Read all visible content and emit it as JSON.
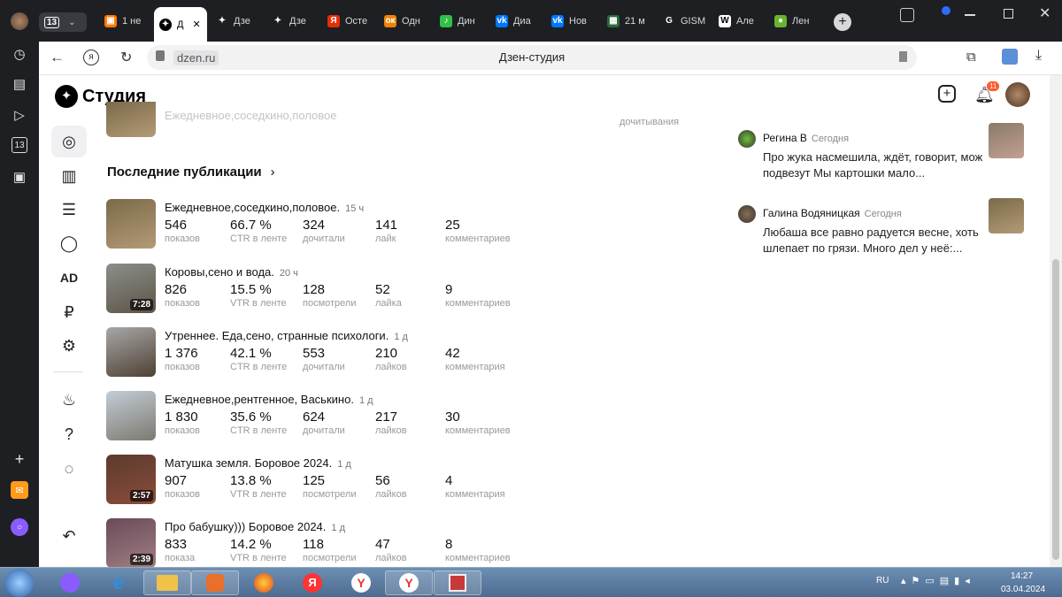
{
  "browser": {
    "tabs": [
      {
        "label": "1 не",
        "color": "#ff7a00",
        "glyph": "▣"
      },
      {
        "label": "Д",
        "color": "#000000",
        "glyph": "✦",
        "active": true
      },
      {
        "label": "Дзе",
        "color": "#1e1f23",
        "glyph": "✦"
      },
      {
        "label": "Дзе",
        "color": "#1e1f23",
        "glyph": "✦"
      },
      {
        "label": "Осте",
        "color": "#e62e04",
        "glyph": "Я"
      },
      {
        "label": "Одн",
        "color": "#ee8208",
        "glyph": "ок"
      },
      {
        "label": "Дин",
        "color": "#31c048",
        "glyph": "♪"
      },
      {
        "label": "Диа",
        "color": "#0077ff",
        "glyph": "vk"
      },
      {
        "label": "Нов",
        "color": "#0077ff",
        "glyph": "vk"
      },
      {
        "label": "21 м",
        "color": "#2a6b3a",
        "glyph": "▦"
      },
      {
        "label": "GISM",
        "color": "#1e1f23",
        "glyph": "G"
      },
      {
        "label": "Але",
        "color": "#ffffff",
        "glyph": "W"
      },
      {
        "label": "Лен",
        "color": "#6ab42d",
        "glyph": "●"
      }
    ],
    "tab_count_badge": "13",
    "url": "dzen.ru",
    "page_title": "Дзен-студия"
  },
  "studio": {
    "logo_text": "Студия",
    "notification_count": "11",
    "partial_row": {
      "title": "Ежедневное,соседкино,половое",
      "stat_label": "дочитывания"
    },
    "section_title": "Последние публикации",
    "nav_ad_label": "AD",
    "publications": [
      {
        "title": "Ежедневное,соседкино,половое.",
        "age": "15 ч",
        "duration": "",
        "colors": [
          "#7a6a4a",
          "#b49a76"
        ],
        "stats": [
          {
            "v": "546",
            "l": "показов"
          },
          {
            "v": "66.7 %",
            "l": "CTR в ленте"
          },
          {
            "v": "324",
            "l": "дочитали"
          },
          {
            "v": "141",
            "l": "лайк"
          },
          {
            "v": "25",
            "l": "комментариев"
          }
        ]
      },
      {
        "title": "Коровы,сено и вода.",
        "age": "20 ч",
        "duration": "7:28",
        "colors": [
          "#8a8f8a",
          "#5d5346"
        ],
        "stats": [
          {
            "v": "826",
            "l": "показов"
          },
          {
            "v": "15.5 %",
            "l": "VTR в ленте"
          },
          {
            "v": "128",
            "l": "посмотрели"
          },
          {
            "v": "52",
            "l": "лайка"
          },
          {
            "v": "9",
            "l": "комментариев"
          }
        ]
      },
      {
        "title": "Утреннее. Еда,сено, странные психологи.",
        "age": "1 д",
        "duration": "",
        "colors": [
          "#a7a7a9",
          "#4e4132"
        ],
        "stats": [
          {
            "v": "1 376",
            "l": "показов"
          },
          {
            "v": "42.1 %",
            "l": "CTR в ленте"
          },
          {
            "v": "553",
            "l": "дочитали"
          },
          {
            "v": "210",
            "l": "лайков"
          },
          {
            "v": "42",
            "l": "комментария"
          }
        ]
      },
      {
        "title": "Ежедневное,рентгенное, Васькино.",
        "age": "1 д",
        "duration": "",
        "colors": [
          "#c3ccd6",
          "#7c7a70"
        ],
        "stats": [
          {
            "v": "1 830",
            "l": "показов"
          },
          {
            "v": "35.6 %",
            "l": "CTR в ленте"
          },
          {
            "v": "624",
            "l": "дочитали"
          },
          {
            "v": "217",
            "l": "лайков"
          },
          {
            "v": "30",
            "l": "комментариев"
          }
        ]
      },
      {
        "title": "Матушка земля. Боровое 2024.",
        "age": "1 д",
        "duration": "2:57",
        "colors": [
          "#5a3b2e",
          "#8c4c3a"
        ],
        "stats": [
          {
            "v": "907",
            "l": "показов"
          },
          {
            "v": "13.8 %",
            "l": "VTR в ленте"
          },
          {
            "v": "125",
            "l": "посмотрели"
          },
          {
            "v": "56",
            "l": "лайков"
          },
          {
            "v": "4",
            "l": "комментария"
          }
        ]
      },
      {
        "title": "Про бабушку))) Боровое 2024.",
        "age": "1 д",
        "duration": "2:39",
        "colors": [
          "#6a4a5a",
          "#a08080"
        ],
        "stats": [
          {
            "v": "833",
            "l": "показа"
          },
          {
            "v": "14.2 %",
            "l": "VTR в ленте"
          },
          {
            "v": "118",
            "l": "посмотрели"
          },
          {
            "v": "47",
            "l": "лайков"
          },
          {
            "v": "8",
            "l": "комментариев"
          }
        ]
      }
    ],
    "comments": [
      {
        "name": "Регина В",
        "when": "Сегодня",
        "text": "Про жука насмешила, ждёт, говорит, мож подвезут Мы картошки мало...",
        "avatar_color": "#6fbf3a",
        "pic_colors": [
          "#8a7a6a",
          "#c2a090"
        ]
      },
      {
        "name": "Галина Водяницкая",
        "when": "Сегодня",
        "text": "Любаша все равно радуется весне, хоть шлепает по грязи. Много дел у неё:...",
        "avatar_color": "#8a7050",
        "pic_colors": [
          "#7a6a4a",
          "#b49a76"
        ]
      }
    ]
  },
  "taskbar": {
    "lang": "RU",
    "time": "14:27",
    "date": "03.04.2024"
  }
}
